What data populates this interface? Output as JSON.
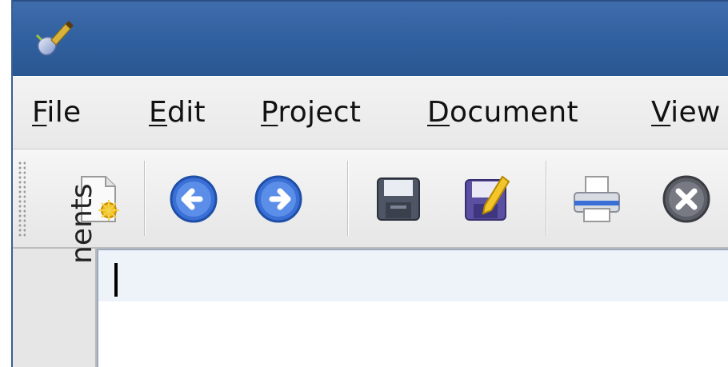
{
  "menubar": {
    "items": [
      {
        "label": "File",
        "mnemonic": "F",
        "rest": "ile"
      },
      {
        "label": "Edit",
        "mnemonic": "E",
        "rest": "dit"
      },
      {
        "label": "Project",
        "mnemonic": "P",
        "rest": "roject"
      },
      {
        "label": "Document",
        "mnemonic": "D",
        "rest": "ocument"
      },
      {
        "label": "View",
        "mnemonic": "V",
        "rest": "iew"
      }
    ]
  },
  "toolbar": {
    "buttons": [
      {
        "icon": "new-document-icon"
      },
      {
        "icon": "back-arrow-icon"
      },
      {
        "icon": "forward-arrow-icon"
      },
      {
        "icon": "save-icon"
      },
      {
        "icon": "save-as-icon"
      },
      {
        "icon": "print-icon"
      },
      {
        "icon": "close-icon"
      }
    ]
  },
  "sidebar": {
    "tab_label": "nents"
  },
  "colors": {
    "titlebar": "#2f5f9e",
    "menubar": "#eeeeee",
    "editor_current_line": "#eef3fa",
    "icon_blue": "#3a6fd6"
  }
}
